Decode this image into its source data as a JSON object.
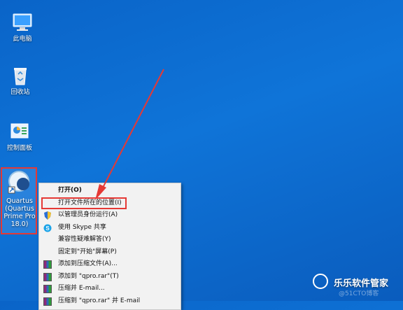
{
  "desktop": {
    "icons": [
      {
        "label": "此电脑"
      },
      {
        "label": "回收站"
      },
      {
        "label": "控制面板"
      },
      {
        "label": "Quartus (Quartus Prime Pro 18.0)"
      }
    ]
  },
  "context_menu": {
    "items": [
      {
        "label": "打开(O)"
      },
      {
        "label": "打开文件所在的位置(I)"
      },
      {
        "label": "以管理员身份运行(A)",
        "icon": "shield-icon"
      },
      {
        "label": "使用 Skype 共享",
        "icon": "skype-icon"
      },
      {
        "label": "兼容性疑难解答(Y)"
      },
      {
        "label": "固定到\"开始\"屏幕(P)"
      },
      {
        "label": "添加到压缩文件(A)...",
        "icon": "winrar-icon"
      },
      {
        "label": "添加到 \"qpro.rar\"(T)",
        "icon": "winrar-icon"
      },
      {
        "label": "压缩并 E-mail...",
        "icon": "winrar-icon"
      },
      {
        "label": "压缩到 \"qpro.rar\" 并 E-mail",
        "icon": "winrar-icon"
      }
    ]
  },
  "watermark": {
    "brand": "乐乐软件管家",
    "faint": "@51CTO博客"
  },
  "colors": {
    "desktop": "#0f74d8",
    "highlight": "#e53935"
  }
}
